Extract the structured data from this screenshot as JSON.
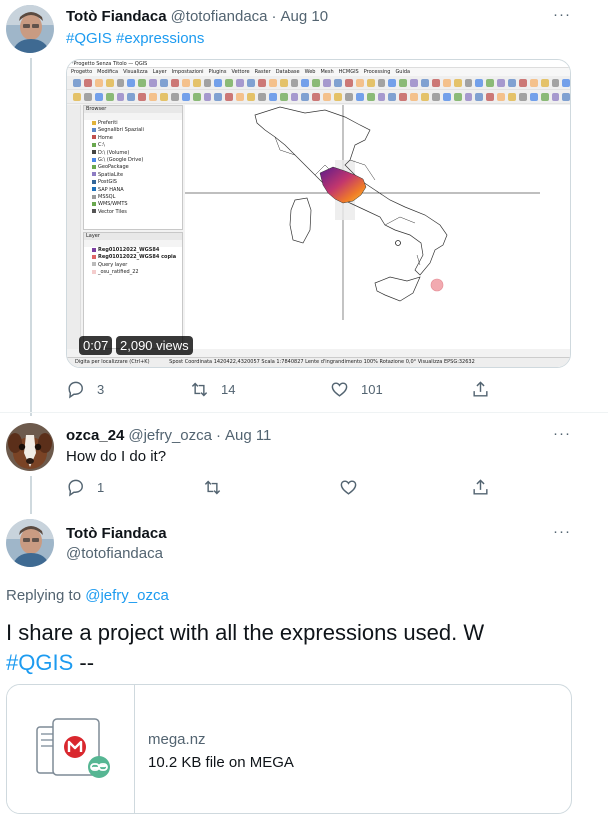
{
  "tweet1": {
    "author_name": "Totò Fiandaca",
    "handle": "@totofiandaca",
    "separator": "·",
    "date": "Aug 10",
    "more": "···",
    "text": "#QGIS #expressions",
    "video": {
      "elapsed": "0:07",
      "views": "2,090 views",
      "qgis_title": "*Progetto Senza Titolo — QGIS",
      "menu": [
        "Progetto",
        "Modifica",
        "Visualizza",
        "Layer",
        "Impostazioni",
        "Plugins",
        "Vettore",
        "Raster",
        "Database",
        "Web",
        "Mesh",
        "HCMGIS",
        "Processing",
        "Guida"
      ],
      "browser_title": "Browser",
      "browser_items": [
        "Preferiti",
        "Segnalibri Spaziali",
        "Home",
        "C:\\",
        "D:\\ (Volume)",
        "G:\\ (Google Drive)",
        "GeoPackage",
        "SpatiaLite",
        "PostGIS",
        "SAP HANA",
        "MSSQL",
        "WMS/WMTS",
        "Vector Tiles"
      ],
      "layer_title": "Layer",
      "layer_items": [
        "Reg01012022_WGS84",
        "Reg01012022_WGS84 copia",
        "Query layer",
        "_osu_ratified_22"
      ],
      "status_search": "Digita per localizzare (Ctrl+K)",
      "status_text": "Spost  Coordinata  1420422,4320057  Scala 1:7840827  Lente d'ingrandimento 100%  Rotazione 0,0°  Visualizza  EPSG:32632"
    },
    "actions": {
      "replies": "3",
      "retweets": "14",
      "likes": "101"
    }
  },
  "tweet2": {
    "author_name": "ozca_24",
    "handle": "@jefry_ozca",
    "separator": "·",
    "date": "Aug 11",
    "more": "···",
    "text": "How do I do it?",
    "actions": {
      "replies": "1"
    }
  },
  "tweet3": {
    "author_name": "Totò Fiandaca",
    "handle": "@totofiandaca",
    "more": "···",
    "replying_prefix": "Replying to",
    "replying_to": "@jefry_ozca",
    "text_main": "I share a project with all the expressions used. W",
    "text_hashtag": "#QGIS",
    "text_tail": "--",
    "card": {
      "domain": "mega.nz",
      "description": "10.2 KB file on MEGA",
      "brand_color": "#d9272e"
    }
  },
  "colors": {
    "accent": "#1d9bf0",
    "muted": "#536471",
    "border": "#cfd9de"
  }
}
